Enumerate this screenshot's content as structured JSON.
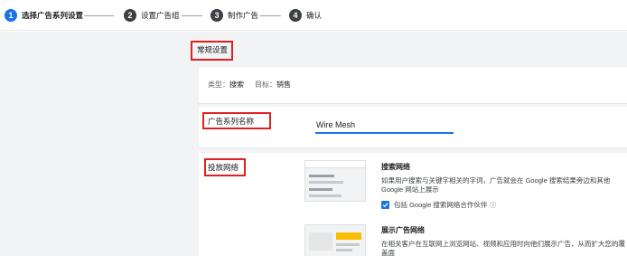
{
  "steps": [
    {
      "number": "1",
      "label": "选择广告系列设置",
      "state": "active"
    },
    {
      "number": "2",
      "label": "设置广告组",
      "state": "todo"
    },
    {
      "number": "3",
      "label": "制作广告",
      "state": "todo"
    },
    {
      "number": "4",
      "label": "确认",
      "state": "todo"
    }
  ],
  "general": {
    "title": "常规设置",
    "type_label": "类型：",
    "type_value": "搜索",
    "goal_label": "目标：",
    "goal_value": "销售"
  },
  "campaign_name": {
    "label": "广告系列名称",
    "value": "Wire Mesh"
  },
  "networks": {
    "label": "投放网络",
    "search": {
      "title": "搜索网络",
      "description": "如果用户搜索与关键字相关的字词，广告就会在 Google 搜索结果旁边和其他 Google 网站上展示",
      "checkbox_label": "包括 Google 搜索网络合作伙伴",
      "checkbox_checked": true
    },
    "display": {
      "title": "展示广告网络",
      "description": "在相关客户在互联网上浏览网站、视频和应用时向他们展示广告，从而扩大您的覆盖面"
    }
  },
  "colors": {
    "accent": "#1a73e8",
    "highlight": "#e02020"
  }
}
